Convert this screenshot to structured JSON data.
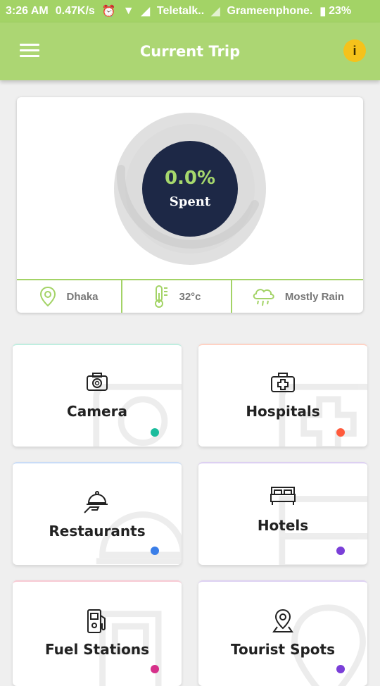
{
  "status_bar": {
    "time": "3:26 AM",
    "speed": "0.47K/s",
    "carrier1": "Teletalk..",
    "carrier2": "Grameenphone.",
    "battery": "23%"
  },
  "app_bar": {
    "title": "Current Trip",
    "info_label": "i"
  },
  "summary": {
    "spent_value": "0.0%",
    "spent_label": "Spent",
    "progress_fraction": 0.0,
    "location": "Dhaka",
    "temperature": "32°c",
    "weather": "Mostly Rain"
  },
  "colors": {
    "accent": "#a3d366",
    "ring_center": "#1d2846",
    "info": "#f5c21b"
  },
  "tiles": [
    {
      "label": "Camera",
      "icon": "camera-icon",
      "dot": "#1abc9c"
    },
    {
      "label": "Hospitals",
      "icon": "hospital-icon",
      "dot": "#ff5a3c"
    },
    {
      "label": "Restaurants",
      "icon": "restaurant-icon",
      "dot": "#3a7ee8"
    },
    {
      "label": "Hotels",
      "icon": "bed-icon",
      "dot": "#7a3fd8"
    },
    {
      "label": "Fuel Stations",
      "icon": "fuel-icon",
      "dot": "#d6308a"
    },
    {
      "label": "Tourist Spots",
      "icon": "location-pin-icon",
      "dot": "#7a3fd8"
    }
  ]
}
